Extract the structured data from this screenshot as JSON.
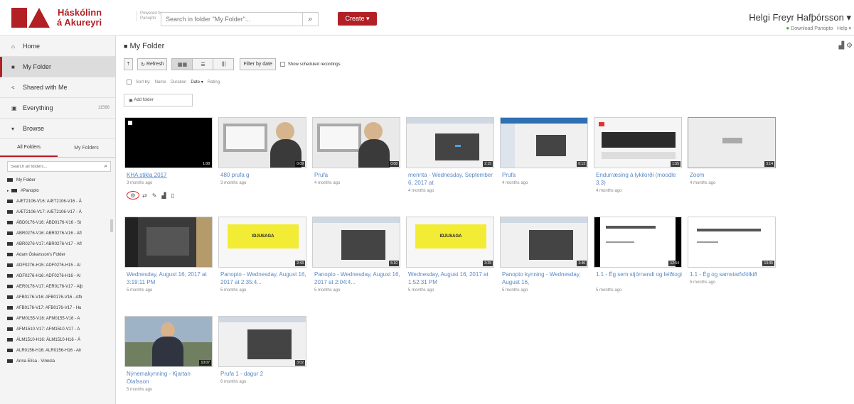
{
  "brand": {
    "name_line1": "Háskólinn",
    "name_line2": "á Akureyri",
    "powered_line1": "Powered by",
    "powered_line2": "Panopto"
  },
  "search": {
    "placeholder": "Search in folder \"My Folder\"..."
  },
  "create": {
    "label": "Create ▾"
  },
  "user": {
    "name": "Helgi Freyr Hafþórsson ▾",
    "download": "Download Panopto",
    "help": "Help ▾"
  },
  "sidebar": {
    "nav": [
      {
        "label": "Home"
      },
      {
        "label": "My Folder"
      },
      {
        "label": "Shared with Me"
      },
      {
        "label": "Everything",
        "count": "11566"
      },
      {
        "label": "Browse"
      }
    ],
    "tabs": [
      "All Folders",
      "My Folders"
    ],
    "folder_search_placeholder": "Search all folders...",
    "folders": [
      "My Folder",
      "#Panopto",
      "AÆT2106-V16: AÆT2106-V16 - Á",
      "AÆT2106-V17: AÆT2106-V17 - Á",
      "ÁBD0176-V16: ÁBD0176-V16 - St",
      "ABR0276-V16: ABR0276-V16 - Afl",
      "ABR0276-V17: ABR0276-V17 - Afl",
      "Adam Óskarsson's Folder",
      "ADF0276-H15: ADF0276-H15 - Al",
      "ADF0276-H16: ADF0276-H16 - Al",
      "AER0176-V17: AER0176-V17 - Alþ",
      "AFB0176-V16: AFB0176-V16 - Afb",
      "AFB0176-V17: AFB0176-V17 - Hu",
      "AFM0155-V16: AFM0155-V16 - A",
      "AFM1510-V17: AFM1510-V17 - A",
      "ÁLM1510-H16: ÁLM1510-H16 - Á",
      "ALR0156-H16: ALR0156-H16 - Alr",
      "Anna Elísa - Vinnsla"
    ]
  },
  "main": {
    "title": "My Folder",
    "toolbar": {
      "refresh": "Refresh",
      "filter": "Filter by date",
      "scheduled": "Show scheduled recordings"
    },
    "sort": {
      "label": "Sort by:",
      "options": [
        "Name",
        "Duration",
        "Date ▾",
        "Rating"
      ]
    },
    "add_folder": "Add folder",
    "sessions": [
      {
        "title": "KHA stikla 2017",
        "date": "3 months ago",
        "duration": "1:08"
      },
      {
        "title": "480 prufa g",
        "date": "3 months ago",
        "duration": "0:09"
      },
      {
        "title": "Prufa",
        "date": "4 months ago",
        "duration": "0:08"
      },
      {
        "title": "mennta - Wednesday, September 6, 2017 at",
        "date": "4 months ago",
        "duration": "2:15"
      },
      {
        "title": "Prufa",
        "date": "4 months ago",
        "duration": "0:13"
      },
      {
        "title": "Endurræsing á lykilorði (moodle 3.3)",
        "date": "4 months ago",
        "duration": "1:55"
      },
      {
        "title": "Zoom",
        "date": "4 months ago",
        "duration": "3:14"
      },
      {
        "title": "Wednesday, August 16, 2017 at 3:19:11 PM",
        "date": "5 months ago",
        "duration": ""
      },
      {
        "title": "Panopto - Wednesday, August 16, 2017 at 2:35:4...",
        "date": "5 months ago",
        "duration": "2:43"
      },
      {
        "title": "Panopto - Wednesday, August 16, 2017 at 2:04:4...",
        "date": "5 months ago",
        "duration": "5:10"
      },
      {
        "title": "Wednesday, August 16, 2017 at 1:52:31 PM",
        "date": "5 months ago",
        "duration": "3:25"
      },
      {
        "title": "Panopto kynning - Wednesday, August 16,",
        "date": "5 months ago",
        "duration": "1:40"
      },
      {
        "title": "1.1 - Ég sem stjórnandi og leiðtogi",
        "date": "5 months ago",
        "duration": "12:54"
      },
      {
        "title": "1.1 - Ég og samstarfsfólkið",
        "date": "5 months ago",
        "duration": "13:35"
      },
      {
        "title": "Nýnemakynning - Kjartan Ólafsson",
        "date": "5 months ago",
        "duration": "10:07"
      },
      {
        "title": "Prufa 1 - dagur 2",
        "date": "6 months ago",
        "duration": "3:02"
      }
    ],
    "thumb_banner": "IDJUSAGA"
  },
  "colors": {
    "brand": "#b21f24",
    "link": "#5b88c4"
  }
}
